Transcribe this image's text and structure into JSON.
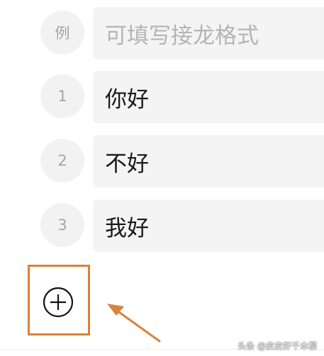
{
  "list": {
    "example_badge": "例",
    "example_placeholder": "可填写接龙格式",
    "items": [
      {
        "number": "1",
        "value": "你好"
      },
      {
        "number": "2",
        "value": "不好"
      },
      {
        "number": "3",
        "value": "我好"
      }
    ]
  },
  "add_icon": "plus-circle-icon",
  "annotation": {
    "color": "#d9823a"
  },
  "watermark": "头条 @皮皮虾千本樱"
}
